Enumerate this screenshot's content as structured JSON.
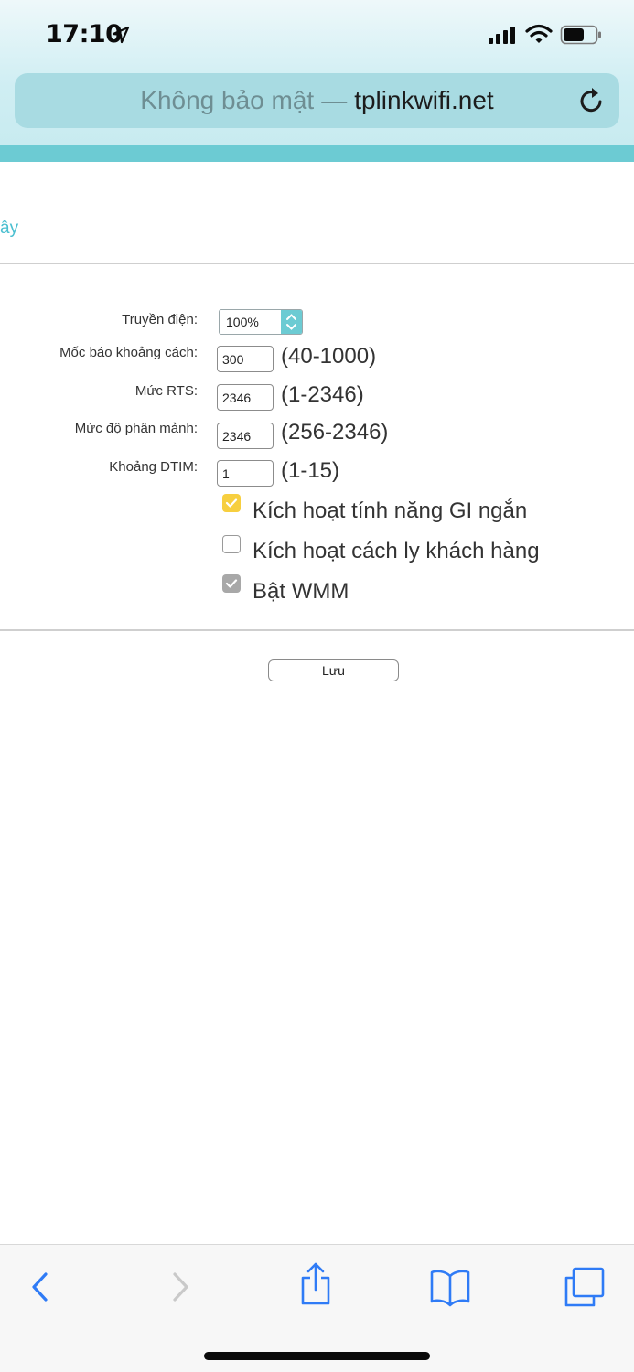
{
  "status_bar": {
    "time": "17:10"
  },
  "url_bar": {
    "security_text": "Không bảo mật",
    "separator": "—",
    "host": "tplinkwifi.net"
  },
  "breadcrumb": "ây",
  "form": {
    "transmit_power": {
      "label": "Truyền điện:",
      "value": "100%"
    },
    "beacon_interval": {
      "label": "Mốc báo khoảng cách:",
      "value": "300",
      "range": "(40-1000)"
    },
    "rts_threshold": {
      "label": "Mức RTS:",
      "value": "2346",
      "range": "(1-2346)"
    },
    "fragmentation": {
      "label": "Mức độ phân mảnh:",
      "value": "2346",
      "range": "(256-2346)"
    },
    "dtim_interval": {
      "label": "Khoảng DTIM:",
      "value": "1",
      "range": "(1-15)"
    },
    "short_gi": {
      "label": "Kích hoạt tính năng GI ngắn",
      "checked": true
    },
    "client_isolation": {
      "label": "Kích hoạt cách ly khách hàng",
      "checked": false
    },
    "wmm": {
      "label": "Bật WMM",
      "checked": true,
      "disabled": true
    },
    "save_label": "Lưu"
  },
  "colors": {
    "accent": "#6ccbd3",
    "link": "#4bbfd0",
    "checkbox_yellow": "#f7cf3f"
  },
  "toolbar_icons": [
    "back-icon",
    "forward-icon",
    "share-icon",
    "bookmarks-icon",
    "tabs-icon"
  ]
}
